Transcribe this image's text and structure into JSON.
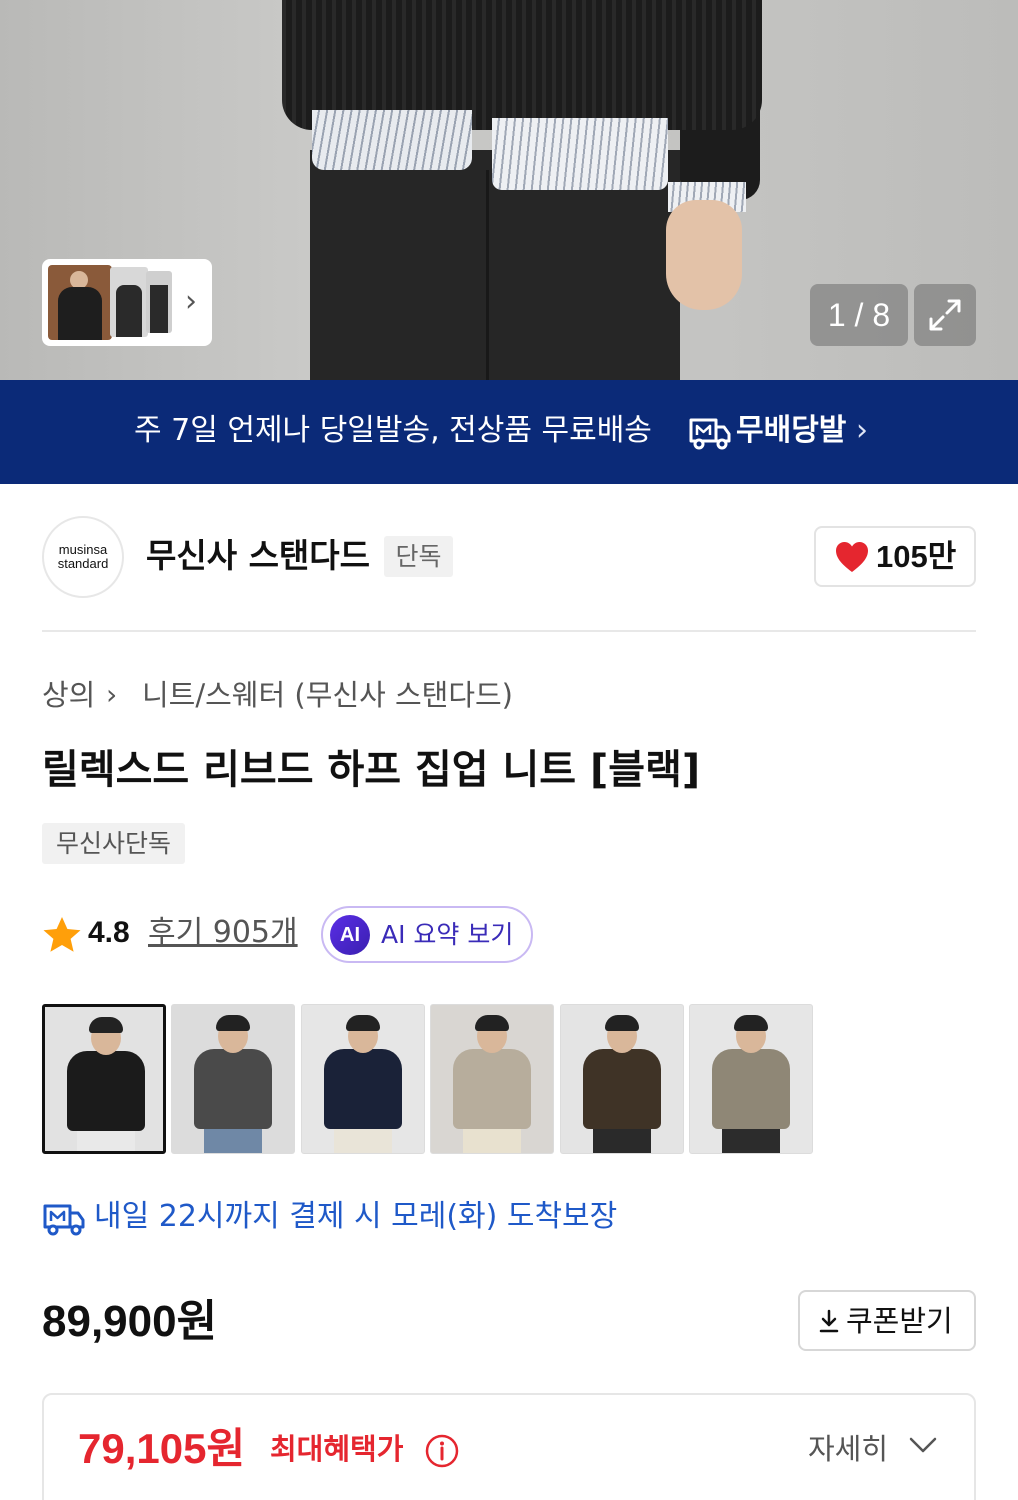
{
  "gallery": {
    "counter": "1 / 8",
    "icons": [
      "chevron-right-icon",
      "expand-icon"
    ]
  },
  "banner": {
    "message": "주 7일 언제나 당일발송, 전상품 무료배송",
    "brand": "무배당발",
    "icons": [
      "delivery-truck-icon",
      "chevron-right-icon"
    ]
  },
  "brand": {
    "logo_line1": "musinsa",
    "logo_line2": "standard",
    "name": "무신사 스탠다드",
    "badge": "단독",
    "likes": "105만"
  },
  "breadcrumb": {
    "level1": "상의",
    "separator": "›",
    "level2": "니트/스웨터 (무신사 스탠다드)"
  },
  "product": {
    "title": "릴렉스드 리브드 하프 집업 니트 [블랙]",
    "tag": "무신사단독",
    "rating": "4.8",
    "reviews": "후기 905개",
    "ai_badge": "AI",
    "ai_label": "AI 요약 보기"
  },
  "swatches": [
    {
      "name": "black",
      "color": "#1b1b1b",
      "selected": true
    },
    {
      "name": "charcoal",
      "color": "#4a4a4a",
      "selected": false
    },
    {
      "name": "navy",
      "color": "#1a2238",
      "selected": false
    },
    {
      "name": "beige",
      "color": "#b7ad9c",
      "selected": false
    },
    {
      "name": "brown",
      "color": "#3f3326",
      "selected": false
    },
    {
      "name": "khaki",
      "color": "#8f8776",
      "selected": false
    }
  ],
  "delivery": {
    "text": "내일 22시까지 결제 시 모레(화) 도착보장",
    "color": "#1f59c8"
  },
  "price": {
    "original": "89,900원",
    "coupon_label": "쿠폰받기",
    "benefit_price": "79,105원",
    "benefit_label": "최대혜택가",
    "detail_label": "자세히",
    "accent": "#e5262f"
  },
  "colors": {
    "banner_bg": "#0b2a78",
    "ai_accent": "#3a2bb8"
  }
}
